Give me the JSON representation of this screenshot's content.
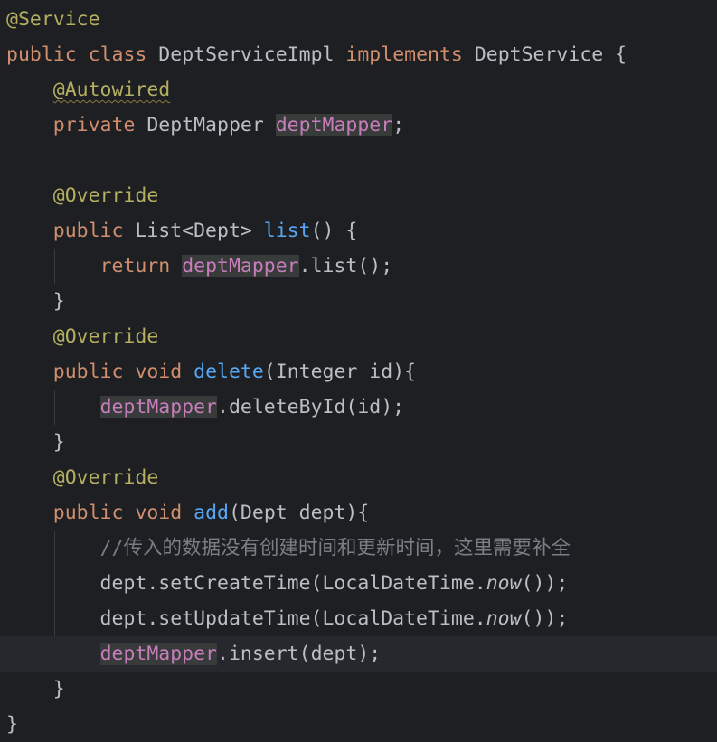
{
  "editor": {
    "language": "java",
    "colors": {
      "background": "#1e1f22",
      "current_line": "#26282e",
      "annotation": "#b3ae60",
      "keyword": "#cf8e6d",
      "method_declaration": "#56a8f5",
      "field": "#c77dbb",
      "default_text": "#bcbec4",
      "comment": "#7a7e85",
      "usage_highlight": "#373b39"
    },
    "current_line_index": 18,
    "lines": [
      {
        "tokens": [
          {
            "text": "@Service",
            "type": "ann"
          }
        ]
      },
      {
        "tokens": [
          {
            "text": "public",
            "type": "kw"
          },
          {
            "text": " ",
            "type": "plain"
          },
          {
            "text": "class",
            "type": "kw"
          },
          {
            "text": " DeptServiceImpl ",
            "type": "plain"
          },
          {
            "text": "implements",
            "type": "kw"
          },
          {
            "text": " DeptService {",
            "type": "plain"
          }
        ]
      },
      {
        "tokens": [
          {
            "text": "    ",
            "type": "plain"
          },
          {
            "text": "@Autowired",
            "type": "ann",
            "squiggle": true
          }
        ]
      },
      {
        "tokens": [
          {
            "text": "    ",
            "type": "plain"
          },
          {
            "text": "private",
            "type": "kw"
          },
          {
            "text": " DeptMapper ",
            "type": "plain"
          },
          {
            "text": "deptMapper",
            "type": "field",
            "usage": true
          },
          {
            "text": ";",
            "type": "plain"
          }
        ]
      },
      {
        "tokens": []
      },
      {
        "tokens": [
          {
            "text": "    ",
            "type": "plain"
          },
          {
            "text": "@Override",
            "type": "ann"
          }
        ]
      },
      {
        "tokens": [
          {
            "text": "    ",
            "type": "plain"
          },
          {
            "text": "public",
            "type": "kw"
          },
          {
            "text": " List<Dept> ",
            "type": "plain"
          },
          {
            "text": "list",
            "type": "fn"
          },
          {
            "text": "() {",
            "type": "plain"
          }
        ]
      },
      {
        "tokens": [
          {
            "text": "        ",
            "type": "plain"
          },
          {
            "text": "return",
            "type": "kw"
          },
          {
            "text": " ",
            "type": "plain"
          },
          {
            "text": "deptMapper",
            "type": "field",
            "usage": true
          },
          {
            "text": ".list();",
            "type": "plain"
          }
        ]
      },
      {
        "tokens": [
          {
            "text": "    }",
            "type": "plain"
          }
        ]
      },
      {
        "tokens": [
          {
            "text": "    ",
            "type": "plain"
          },
          {
            "text": "@Override",
            "type": "ann"
          }
        ]
      },
      {
        "tokens": [
          {
            "text": "    ",
            "type": "plain"
          },
          {
            "text": "public",
            "type": "kw"
          },
          {
            "text": " ",
            "type": "plain"
          },
          {
            "text": "void",
            "type": "kw"
          },
          {
            "text": " ",
            "type": "plain"
          },
          {
            "text": "delete",
            "type": "fn"
          },
          {
            "text": "(Integer id){",
            "type": "plain"
          }
        ]
      },
      {
        "tokens": [
          {
            "text": "        ",
            "type": "plain"
          },
          {
            "text": "deptMapper",
            "type": "field",
            "usage": true
          },
          {
            "text": ".deleteById(id);",
            "type": "plain"
          }
        ]
      },
      {
        "tokens": [
          {
            "text": "    }",
            "type": "plain"
          }
        ]
      },
      {
        "tokens": [
          {
            "text": "    ",
            "type": "plain"
          },
          {
            "text": "@Override",
            "type": "ann"
          }
        ]
      },
      {
        "tokens": [
          {
            "text": "    ",
            "type": "plain"
          },
          {
            "text": "public",
            "type": "kw"
          },
          {
            "text": " ",
            "type": "plain"
          },
          {
            "text": "void",
            "type": "kw"
          },
          {
            "text": " ",
            "type": "plain"
          },
          {
            "text": "add",
            "type": "fn"
          },
          {
            "text": "(Dept dept){",
            "type": "plain"
          }
        ]
      },
      {
        "tokens": [
          {
            "text": "        ",
            "type": "plain"
          },
          {
            "text": "//传入的数据没有创建时间和更新时间，这里需要补全",
            "type": "comment"
          }
        ]
      },
      {
        "tokens": [
          {
            "text": "        dept.setCreateTime(LocalDateTime.",
            "type": "plain"
          },
          {
            "text": "now",
            "type": "plain",
            "italic": true
          },
          {
            "text": "());",
            "type": "plain"
          }
        ]
      },
      {
        "tokens": [
          {
            "text": "        dept.setUpdateTime(LocalDateTime.",
            "type": "plain"
          },
          {
            "text": "now",
            "type": "plain",
            "italic": true
          },
          {
            "text": "());",
            "type": "plain"
          }
        ]
      },
      {
        "tokens": [
          {
            "text": "        ",
            "type": "plain"
          },
          {
            "text": "deptMapper",
            "type": "field",
            "usage": true
          },
          {
            "text": ".insert(dept);",
            "type": "plain"
          }
        ]
      },
      {
        "tokens": [
          {
            "text": "    }",
            "type": "plain"
          }
        ]
      },
      {
        "tokens": [
          {
            "text": "}",
            "type": "plain"
          }
        ]
      }
    ]
  }
}
